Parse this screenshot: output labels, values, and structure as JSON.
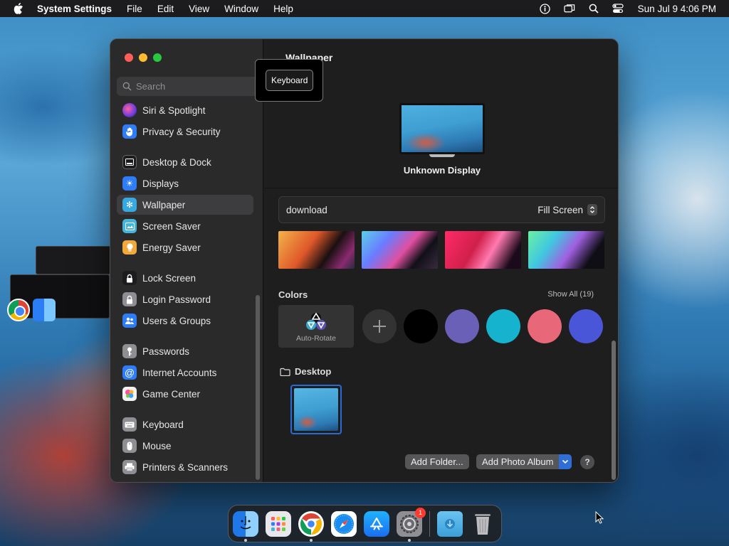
{
  "menubar": {
    "app_name": "System Settings",
    "menus": [
      "File",
      "Edit",
      "View",
      "Window",
      "Help"
    ],
    "clock": "Sun Jul 9  4:06 PM"
  },
  "sidebar": {
    "search_placeholder": "Search",
    "items": [
      {
        "label": "Siri & Spotlight",
        "icon": "siri-icon",
        "color": "#b03ad6"
      },
      {
        "label": "Privacy & Security",
        "icon": "hand-icon",
        "color": "#2f7df6"
      },
      {
        "label": "Desktop & Dock",
        "icon": "dock-icon",
        "color": "#2c2c2e"
      },
      {
        "label": "Displays",
        "icon": "sun-icon",
        "color": "#2f7df6"
      },
      {
        "label": "Wallpaper",
        "icon": "flower-icon",
        "color": "#38a8e0",
        "selected": true
      },
      {
        "label": "Screen Saver",
        "icon": "screen-saver-icon",
        "color": "#46b4d8"
      },
      {
        "label": "Energy Saver",
        "icon": "bulb-icon",
        "color": "#f2a93b"
      },
      {
        "label": "Lock Screen",
        "icon": "lock-icon",
        "color": "#2c2c2e"
      },
      {
        "label": "Login Password",
        "icon": "lock-icon",
        "color": "#8e8e93"
      },
      {
        "label": "Users & Groups",
        "icon": "users-icon",
        "color": "#2f7df6"
      },
      {
        "label": "Passwords",
        "icon": "key-icon",
        "color": "#8e8e93"
      },
      {
        "label": "Internet Accounts",
        "icon": "at-icon",
        "color": "#2f7df6"
      },
      {
        "label": "Game Center",
        "icon": "game-center-icon",
        "color": "#e8e8e8"
      },
      {
        "label": "Keyboard",
        "icon": "keyboard-icon",
        "color": "#8e8e93"
      },
      {
        "label": "Mouse",
        "icon": "mouse-icon",
        "color": "#8e8e93"
      },
      {
        "label": "Printers & Scanners",
        "icon": "printer-icon",
        "color": "#8e8e93"
      }
    ]
  },
  "main": {
    "title": "Wallpaper",
    "display_name": "Unknown Display",
    "current_wallpaper": "download",
    "fit_mode": "Fill Screen",
    "colors_heading": "Colors",
    "show_all": "Show All (19)",
    "auto_rotate": "Auto-Rotate",
    "swatches": [
      "#000000",
      "#6b60b8",
      "#15b3ce",
      "#e8687a",
      "#4a56d8"
    ],
    "desktop_heading": "Desktop",
    "add_folder": "Add Folder...",
    "add_photo_album": "Add Photo Album",
    "help": "?"
  },
  "tooltip": {
    "label": "Keyboard"
  },
  "dock": {
    "apps": [
      {
        "name": "finder-icon",
        "running": true
      },
      {
        "name": "launchpad-icon",
        "running": false
      },
      {
        "name": "chrome-icon",
        "running": true
      },
      {
        "name": "safari-icon",
        "running": false
      },
      {
        "name": "app-store-icon",
        "running": false
      },
      {
        "name": "system-settings-icon",
        "running": true,
        "badge": "1"
      }
    ],
    "badge": "1"
  }
}
